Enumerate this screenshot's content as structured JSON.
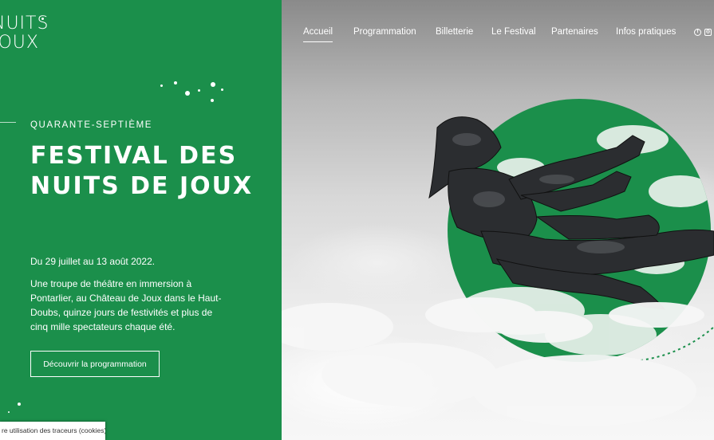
{
  "logo": {
    "line1": "NUITS",
    "line2": "JOUX"
  },
  "hero": {
    "kicker": "QUARANTE-SEPTIÈME",
    "title": "FESTIVAL DES NUITS DE JOUX",
    "dates": "Du 29 juillet au 13 août 2022.",
    "description": "Une troupe de théâtre en immersion à Pontarlier, au Château de Joux dans le Haut-Doubs, quinze jours de festivités et plus de cinq mille spectateurs chaque été.",
    "cta_label": "Découvrir la programmation"
  },
  "nav": {
    "items": [
      "Accueil",
      "Programmation",
      "Billetterie",
      "Le Festival",
      "Partenaires",
      "Infos pratiques"
    ],
    "active": "Accueil",
    "social": [
      {
        "icon": "facebook-icon",
        "glyph": "f"
      },
      {
        "icon": "instagram-icon",
        "glyph": "◎"
      }
    ]
  },
  "cookie": {
    "label": "re utilisation des traceurs (cookies)"
  },
  "colors": {
    "brand_green": "#1b8f4b",
    "text": "#ffffff",
    "armor": "#2b2d30",
    "cloud": "#f2f2f2"
  }
}
